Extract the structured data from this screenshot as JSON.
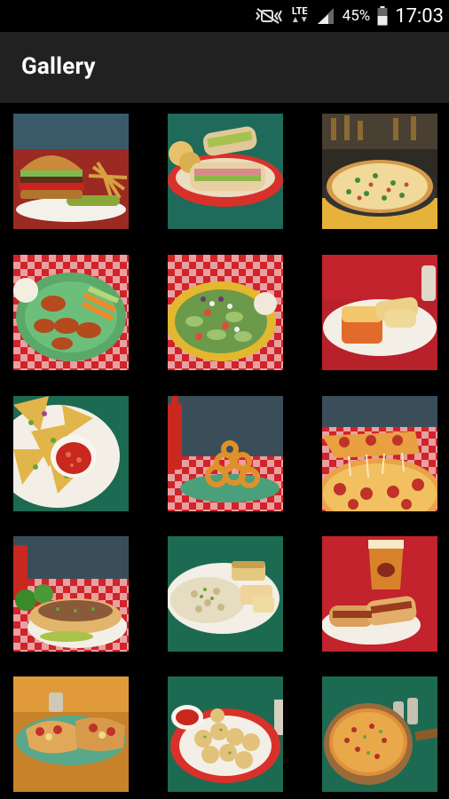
{
  "status_bar": {
    "battery_percent": "45%",
    "time": "17:03",
    "network": "LTE",
    "icons": [
      "mute-vibrate-icon",
      "lte-data-icon",
      "signal-icon",
      "battery-icon"
    ]
  },
  "app_bar": {
    "title": "Gallery"
  },
  "gallery": {
    "items": [
      {
        "subject": "burger"
      },
      {
        "subject": "wrap"
      },
      {
        "subject": "pizza"
      },
      {
        "subject": "wings"
      },
      {
        "subject": "salad"
      },
      {
        "subject": "lasagna"
      },
      {
        "subject": "nachos"
      },
      {
        "subject": "onion-rings"
      },
      {
        "subject": "pizza-slice"
      },
      {
        "subject": "sub-sandwich"
      },
      {
        "subject": "pasta"
      },
      {
        "subject": "sandwich-beer"
      },
      {
        "subject": "calzone"
      },
      {
        "subject": "garlic-knots"
      },
      {
        "subject": "pizza-board"
      }
    ]
  }
}
